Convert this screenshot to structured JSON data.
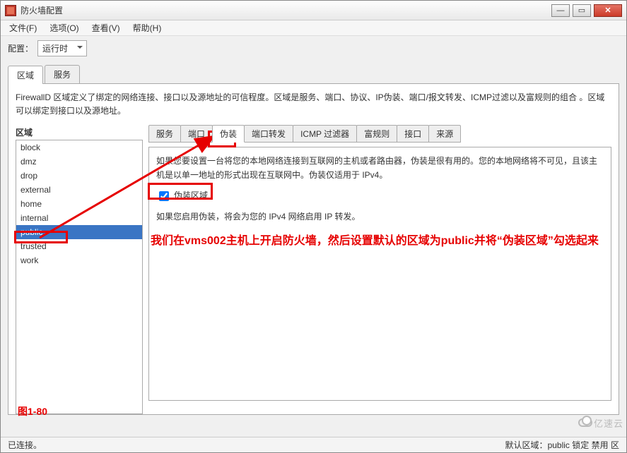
{
  "window": {
    "title": "防火墙配置"
  },
  "menubar": {
    "file": "文件(F)",
    "options": "选项(O)",
    "view": "查看(V)",
    "help": "帮助(H)"
  },
  "config": {
    "label": "配置：",
    "value": "运行时"
  },
  "outer_tabs": {
    "zones": "区域",
    "services": "服务"
  },
  "zones_panel": {
    "description": "FirewallD 区域定义了绑定的网络连接、接口以及源地址的可信程度。区域是服务、端口、协议、IP伪装、端口/报文转发、ICMP过滤以及富规则的组合 。区域可以绑定到接口以及源地址。",
    "col_header": "区域",
    "items": [
      "block",
      "dmz",
      "drop",
      "external",
      "home",
      "internal",
      "public",
      "trusted",
      "work"
    ],
    "selected_index": 6
  },
  "inner_tabs": {
    "items": [
      "服务",
      "端口",
      "伪装",
      "端口转发",
      "ICMP 过滤器",
      "富规则",
      "接口",
      "来源"
    ],
    "active_index": 2
  },
  "masq": {
    "desc1": "如果您要设置一台将您的本地网络连接到互联网的主机或者路由器，伪装是很有用的。您的本地网络将不可见，且该主机是以单一地址的形式出现在互联网中。伪装仅适用于 IPv4。",
    "checkbox_label": "伪装区域",
    "checked": true,
    "desc2": "如果您启用伪装，将会为您的 IPv4 网络启用 IP 转发。"
  },
  "annotations": {
    "instruction": "我们在vms002主机上开启防火墙，然后设置默认的区域为public并将“伪装区域”勾选起来",
    "figure": "图1-80"
  },
  "statusbar": {
    "connected": "已连接。",
    "default_zone_label": "默认区域：",
    "default_zone_value": "public",
    "lock": "锁定",
    "disable": "禁用",
    "trail": "区"
  },
  "watermark": "亿速云"
}
